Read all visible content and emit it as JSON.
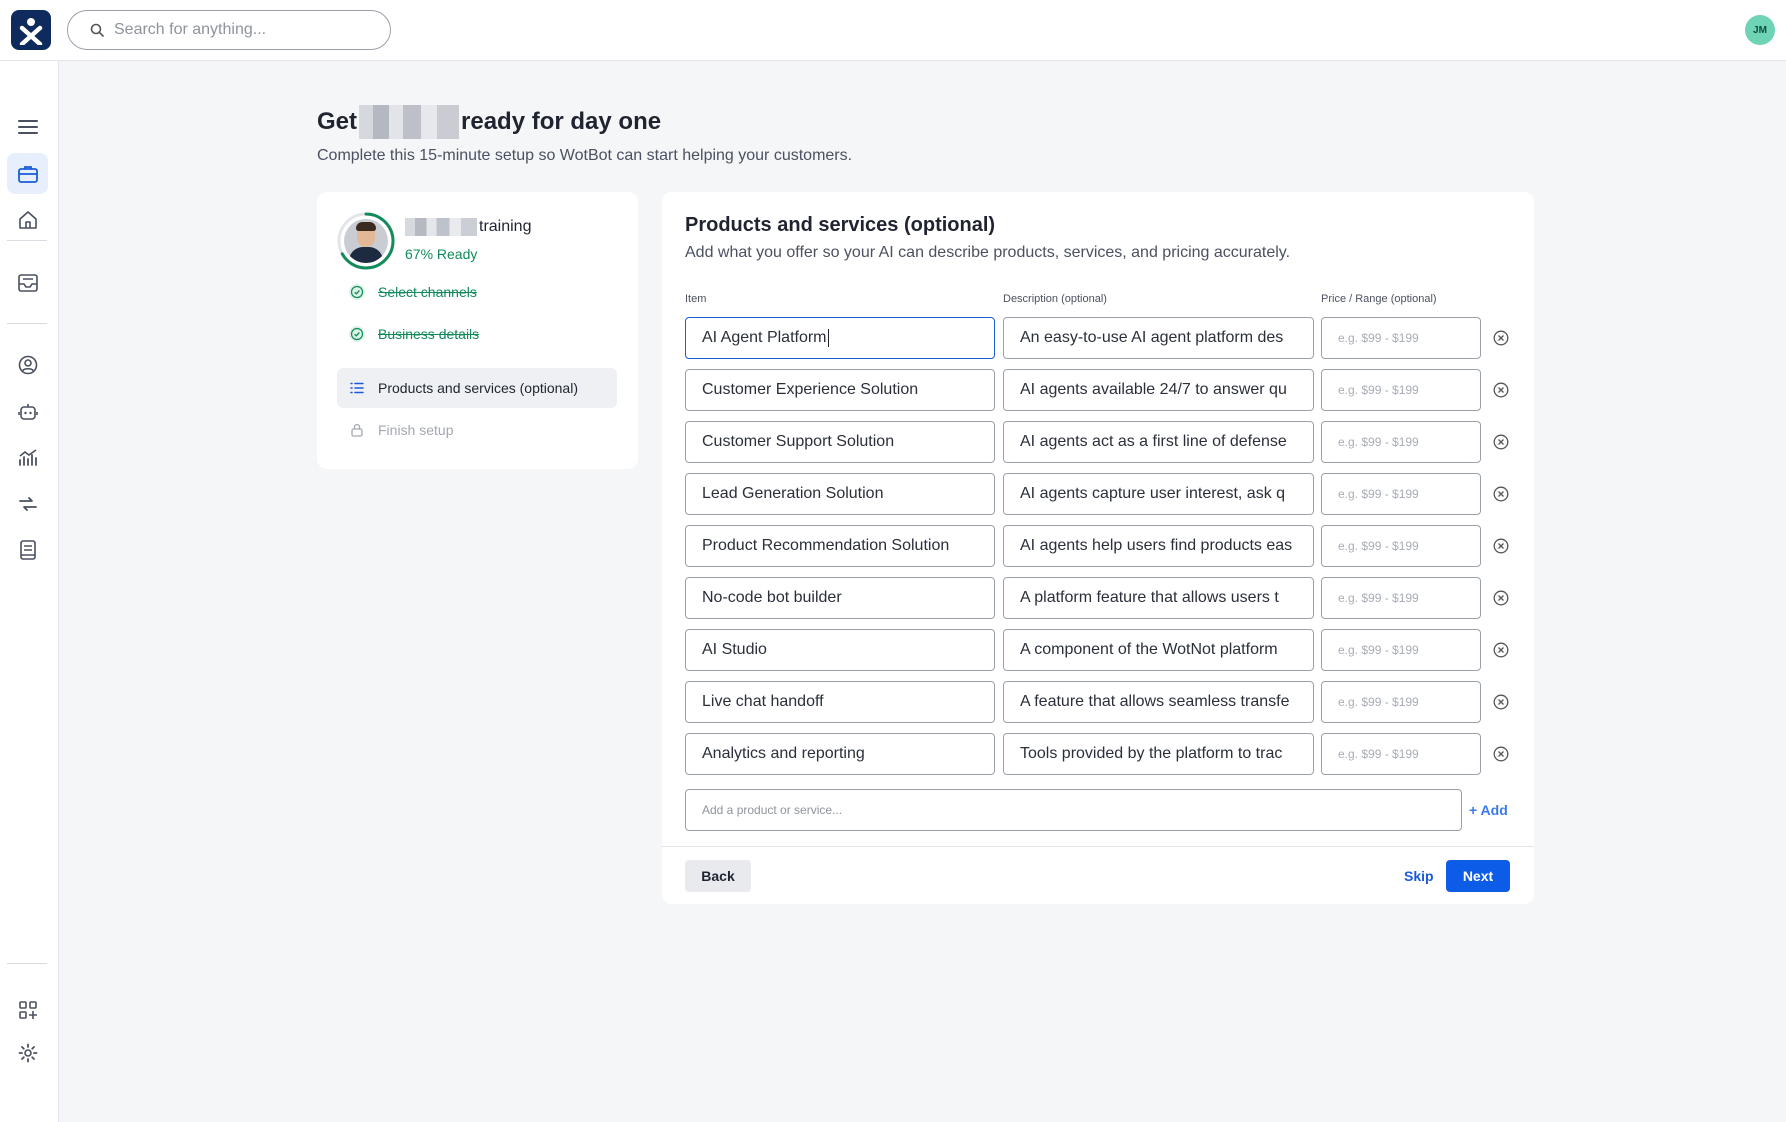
{
  "search": {
    "placeholder": "Search for anything..."
  },
  "user": {
    "initials": "JM"
  },
  "sidebar": {
    "icons": [
      "menu-icon",
      "briefcase-icon",
      "home-icon",
      "inbox-icon",
      "user-circle-icon",
      "bot-icon",
      "analytics-icon",
      "transfer-icon",
      "book-icon",
      "apps-add-icon",
      "settings-icon",
      "help-icon"
    ],
    "help_label": "?"
  },
  "page": {
    "title_before": "Get",
    "title_after": "ready for day one",
    "subtitle": "Complete this 15-minute setup so WotBot can start helping your customers."
  },
  "progress": {
    "name_suffix": "training",
    "ready_text": "67% Ready",
    "ready_fraction": 0.67,
    "accent": "#128a5a",
    "steps": [
      {
        "label": "Select channels",
        "state": "done"
      },
      {
        "label": "Business details",
        "state": "done"
      },
      {
        "label": "Products and services (optional)",
        "state": "active"
      },
      {
        "label": "Finish setup",
        "state": "locked"
      }
    ]
  },
  "products": {
    "title": "Products and services (optional)",
    "subtitle": "Add what you offer so your AI can describe products, services, and pricing accurately.",
    "columns": {
      "item": "Item",
      "description": "Description (optional)",
      "price": "Price / Range (optional)"
    },
    "price_placeholder": "e.g. $99 - $199",
    "rows": [
      {
        "item": "AI Agent Platform",
        "description": "An easy-to-use AI agent platform des"
      },
      {
        "item": "Customer Experience Solution",
        "description": "AI agents available 24/7 to answer qu"
      },
      {
        "item": "Customer Support Solution",
        "description": "AI agents act as a first line of defense"
      },
      {
        "item": "Lead Generation Solution",
        "description": "AI agents capture user interest, ask q"
      },
      {
        "item": "Product Recommendation Solution",
        "description": "AI agents help users find products eas"
      },
      {
        "item": "No-code bot builder",
        "description": "A platform feature that allows users t"
      },
      {
        "item": "AI Studio",
        "description": "A component of the WotNot platform"
      },
      {
        "item": "Live chat handoff",
        "description": "A feature that allows seamless transfe"
      },
      {
        "item": "Analytics and reporting",
        "description": "Tools provided by the platform to trac"
      }
    ],
    "add_placeholder": "Add a product or service...",
    "add_label": "+ Add",
    "back_label": "Back",
    "skip_label": "Skip",
    "next_label": "Next",
    "primary_color": "#0d5ce8"
  }
}
